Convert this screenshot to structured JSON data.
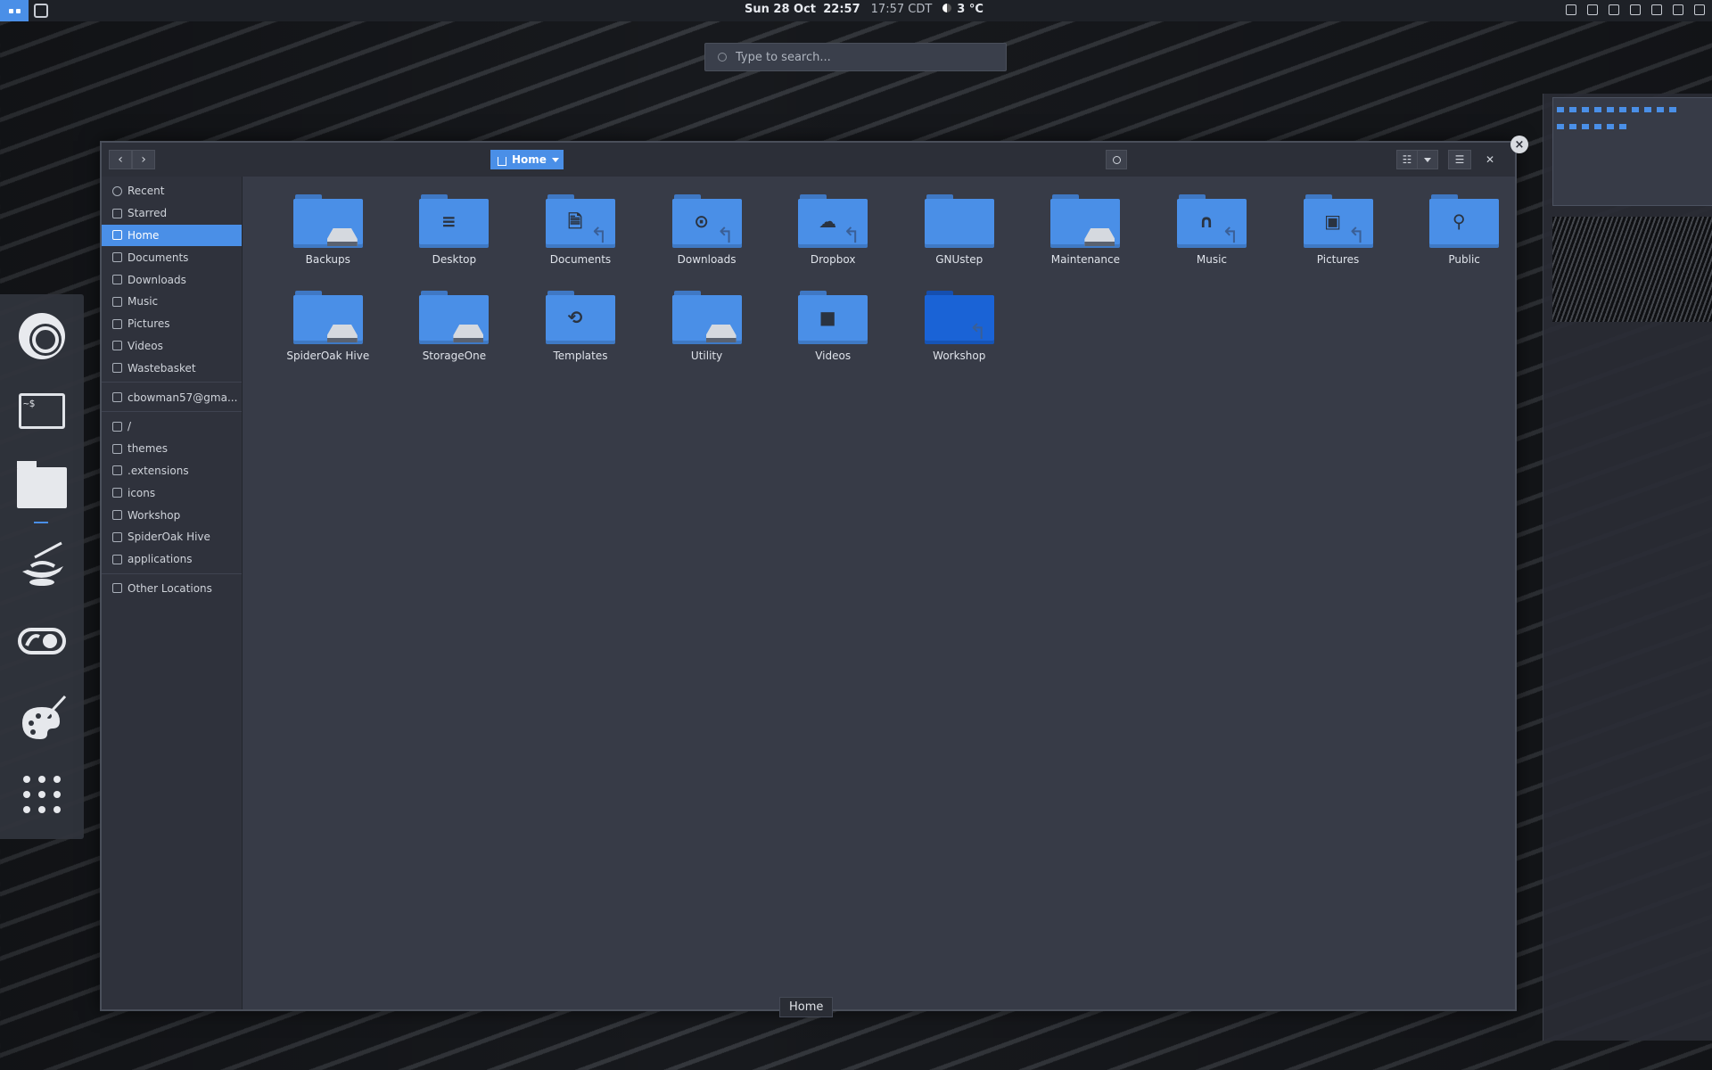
{
  "topbar": {
    "date": "Sun 28 Oct",
    "time": "22:57",
    "secondary_time": "17:57 CDT",
    "weather": "3 °C",
    "tray_icons": [
      "mail-icon",
      "coffee-icon",
      "display-icon",
      "wifi-icon",
      "notification-icon",
      "volume-icon",
      "power-icon"
    ]
  },
  "search": {
    "placeholder": "Type to search..."
  },
  "dock": {
    "items": [
      "chrome-icon",
      "terminal-icon",
      "files-icon",
      "genie-lamp-icon",
      "toggle-app-icon",
      "paint-palette-icon",
      "app-grid-icon"
    ],
    "terminal_text": "~$"
  },
  "window": {
    "path_label": "Home",
    "sidebar": [
      {
        "label": "Recent",
        "icon": "clock-icon"
      },
      {
        "label": "Starred",
        "icon": "star-icon"
      },
      {
        "label": "Home",
        "icon": "home-icon",
        "active": true
      },
      {
        "label": "Documents",
        "icon": "document-icon"
      },
      {
        "label": "Downloads",
        "icon": "download-icon"
      },
      {
        "label": "Music",
        "icon": "music-icon"
      },
      {
        "label": "Pictures",
        "icon": "picture-icon"
      },
      {
        "label": "Videos",
        "icon": "video-icon"
      },
      {
        "label": "Wastebasket",
        "icon": "trash-icon"
      },
      {
        "label": "cbowman57@gma...",
        "icon": "network-drive-icon"
      },
      {
        "label": "/",
        "icon": "folder-icon"
      },
      {
        "label": "themes",
        "icon": "folder-icon"
      },
      {
        "label": ".extensions",
        "icon": "folder-icon"
      },
      {
        "label": "icons",
        "icon": "folder-icon"
      },
      {
        "label": "Workshop",
        "icon": "folder-icon"
      },
      {
        "label": "SpiderOak Hive",
        "icon": "folder-icon"
      },
      {
        "label": "applications",
        "icon": "folder-icon"
      },
      {
        "label": "Other Locations",
        "icon": "plus-icon"
      }
    ],
    "files": [
      {
        "name": "Backups",
        "emblem": "drive"
      },
      {
        "name": "Desktop",
        "emblem": "desktop"
      },
      {
        "name": "Documents",
        "emblem": "document"
      },
      {
        "name": "Downloads",
        "emblem": "download"
      },
      {
        "name": "Dropbox",
        "emblem": "cloud"
      },
      {
        "name": "GNUstep",
        "emblem": "none"
      },
      {
        "name": "Maintenance",
        "emblem": "drive"
      },
      {
        "name": "Music",
        "emblem": "headphones"
      },
      {
        "name": "Pictures",
        "emblem": "picture"
      },
      {
        "name": "Public",
        "emblem": "share"
      },
      {
        "name": "SpiderOak Hive",
        "emblem": "drive"
      },
      {
        "name": "StorageOne",
        "emblem": "drive"
      },
      {
        "name": "Templates",
        "emblem": "template"
      },
      {
        "name": "Utility",
        "emblem": "drive"
      },
      {
        "name": "Videos",
        "emblem": "video"
      },
      {
        "name": "Workshop",
        "emblem": "link",
        "selected_color": "#1a63d6"
      }
    ],
    "tooltip": "Home",
    "accent": "#4a8fe7"
  }
}
